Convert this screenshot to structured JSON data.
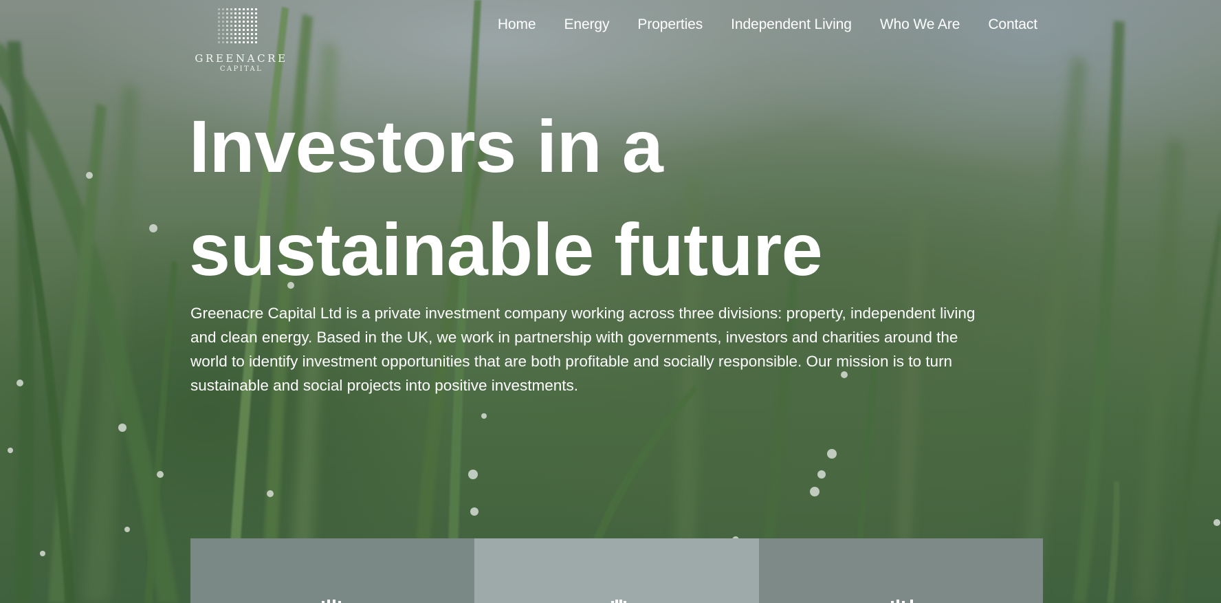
{
  "logo": {
    "name": "GREENACRE",
    "sub": "CAPITAL"
  },
  "nav": {
    "items": [
      {
        "label": "Home"
      },
      {
        "label": "Energy"
      },
      {
        "label": "Properties"
      },
      {
        "label": "Independent Living"
      },
      {
        "label": "Who We Are"
      },
      {
        "label": "Contact"
      }
    ]
  },
  "hero": {
    "headline_line1": "Investors in a",
    "headline_line2": "sustainable future",
    "intro": "Greenacre Capital Ltd is a private investment company working across three divisions: property, independent living and clean energy. Based in the UK, we work in partnership with governments, investors and charities around the world to identify investment opportunities that are both profitable and socially responsible. Our mission is to turn sustainable and social projects into positive investments."
  },
  "cards": [
    {
      "icon": "building-icon",
      "color": "#7a8886"
    },
    {
      "icon": "building-icon",
      "color": "#9eaaa9"
    },
    {
      "icon": "building-icon",
      "color": "#7d8a88"
    }
  ],
  "colors": {
    "text": "#ffffff",
    "card_dark": "#7a8886",
    "card_light": "#9eaaa9"
  }
}
